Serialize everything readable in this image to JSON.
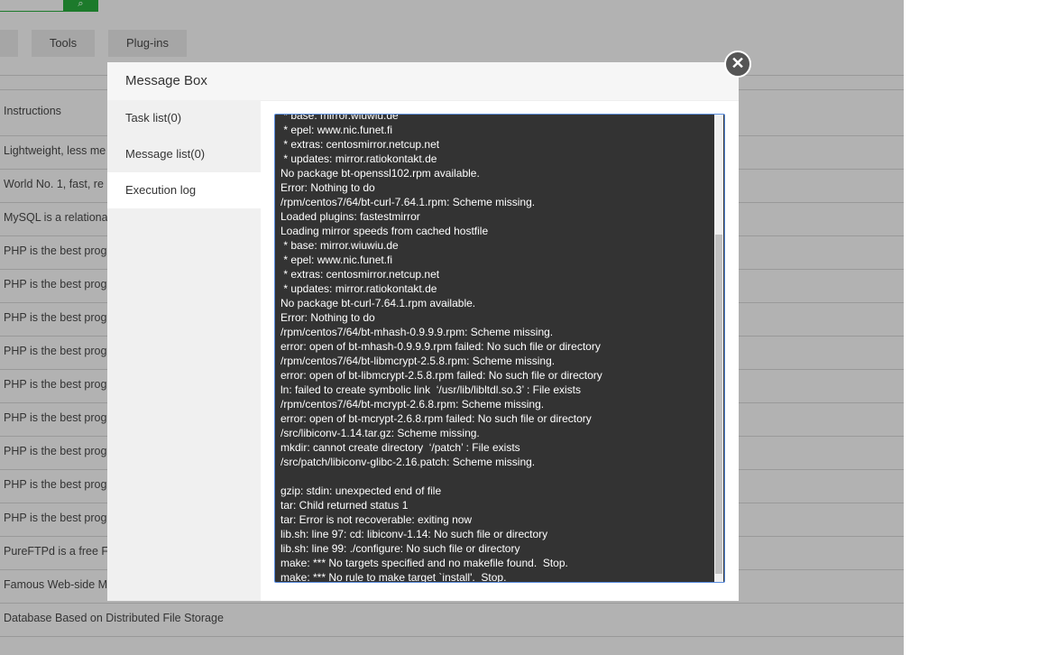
{
  "background": {
    "tabs": [
      "Tools",
      "Plug-ins"
    ],
    "rows": [
      "Instructions",
      "Lightweight, less me",
      "World No. 1, fast, re",
      "MySQL is a relationa",
      "PHP is the best prog",
      "PHP is the best prog",
      "PHP is the best prog",
      "PHP is the best prog",
      "PHP is the best prog",
      "PHP is the best prog",
      "PHP is the best prog",
      "PHP is the best prog",
      "PHP is the best prog",
      "PureFTPd is a free FT",
      "Famous Web-side M",
      "Database Based on Distributed File Storage"
    ]
  },
  "modal": {
    "title": "Message Box",
    "close": "✕",
    "sidebar": [
      "Task list(0)",
      "Message list(0)",
      "Execution log"
    ],
    "log": " * base: mirror.wiuwiu.de\n * epel: www.nic.funet.fi\n * extras: centosmirror.netcup.net\n * updates: mirror.ratiokontakt.de\nNo package bt-openssl102.rpm available.\nError: Nothing to do\n/rpm/centos7/64/bt-curl-7.64.1.rpm: Scheme missing.\nLoaded plugins: fastestmirror\nLoading mirror speeds from cached hostfile\n * base: mirror.wiuwiu.de\n * epel: www.nic.funet.fi\n * extras: centosmirror.netcup.net\n * updates: mirror.ratiokontakt.de\nNo package bt-curl-7.64.1.rpm available.\nError: Nothing to do\n/rpm/centos7/64/bt-mhash-0.9.9.9.rpm: Scheme missing.\nerror: open of bt-mhash-0.9.9.9.rpm failed: No such file or directory\n/rpm/centos7/64/bt-libmcrypt-2.5.8.rpm: Scheme missing.\nerror: open of bt-libmcrypt-2.5.8.rpm failed: No such file or directory\nln: failed to create symbolic link  ‘/usr/lib/libltdl.so.3’ : File exists\n/rpm/centos7/64/bt-mcrypt-2.6.8.rpm: Scheme missing.\nerror: open of bt-mcrypt-2.6.8.rpm failed: No such file or directory\n/src/libiconv-1.14.tar.gz: Scheme missing.\nmkdir: cannot create directory  ‘/patch’ : File exists\n/src/patch/libiconv-glibc-2.16.patch: Scheme missing.\n\ngzip: stdin: unexpected end of file\ntar: Child returned status 1\ntar: Error is not recoverable: exiting now\nlib.sh: line 97: cd: libiconv-1.14: No such file or directory\nlib.sh: line 99: ./configure: No such file or directory\nmake: *** No targets specified and no makefile found.  Stop.\nmake: *** No rule to make target `install'.  Stop."
  }
}
